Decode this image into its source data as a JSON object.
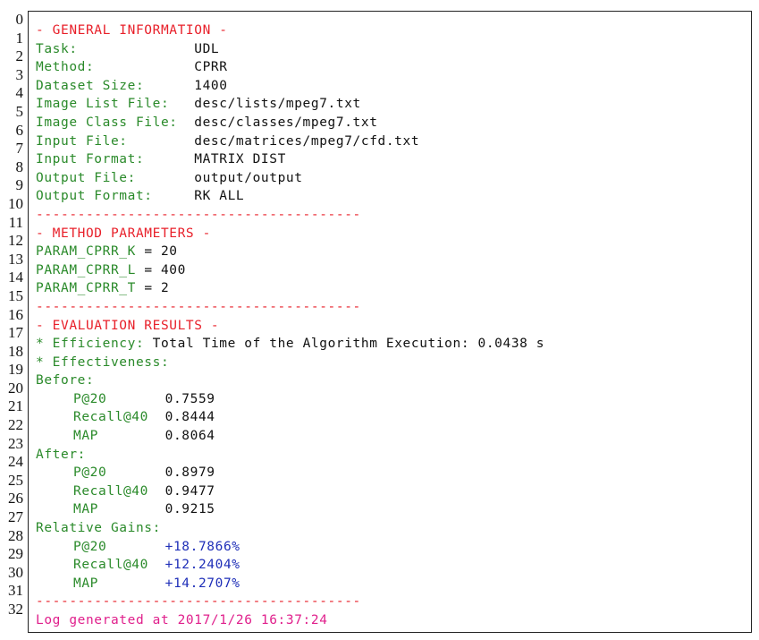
{
  "line_numbers": [
    "0",
    "1",
    "2",
    "3",
    "4",
    "5",
    "6",
    "7",
    "8",
    "9",
    "10",
    "11",
    "12",
    "13",
    "14",
    "15",
    "16",
    "17",
    "18",
    "19",
    "20",
    "21",
    "22",
    "23",
    "24",
    "25",
    "26",
    "27",
    "28",
    "29",
    "30",
    "31",
    "32"
  ],
  "general": {
    "header": "- GENERAL INFORMATION -",
    "rows": [
      {
        "label": "Task:              ",
        "value": "UDL"
      },
      {
        "label": "Method:            ",
        "value": "CPRR"
      },
      {
        "label": "Dataset Size:      ",
        "value": "1400"
      },
      {
        "label": "Image List File:   ",
        "value": "desc/lists/mpeg7.txt"
      },
      {
        "label": "Image Class File:  ",
        "value": "desc/classes/mpeg7.txt"
      },
      {
        "label": "Input File:        ",
        "value": "desc/matrices/mpeg7/cfd.txt"
      },
      {
        "label": "Input Format:      ",
        "value": "MATRIX DIST"
      },
      {
        "label": "Output File:       ",
        "value": "output/output"
      },
      {
        "label": "Output Format:     ",
        "value": "RK ALL"
      }
    ]
  },
  "separator": "---------------------------------------",
  "method": {
    "header": "- METHOD PARAMETERS -",
    "params": [
      {
        "name": "PARAM_CPRR_K",
        "value": "= 20"
      },
      {
        "name": "PARAM_CPRR_L",
        "value": "= 400"
      },
      {
        "name": "PARAM_CPRR_T",
        "value": "= 2"
      }
    ]
  },
  "evaluation": {
    "header": "- EVALUATION RESULTS -",
    "efficiency_label": "* Efficiency:",
    "efficiency_value": "Total Time of the Algorithm Execution: 0.0438 s",
    "effectiveness_label": "* Effectiveness:",
    "before_label": "Before:",
    "before": [
      {
        "metric": "P@20       ",
        "value": "0.7559"
      },
      {
        "metric": "Recall@40  ",
        "value": "0.8444"
      },
      {
        "metric": "MAP        ",
        "value": "0.8064"
      }
    ],
    "after_label": "After:",
    "after": [
      {
        "metric": "P@20       ",
        "value": "0.8979"
      },
      {
        "metric": "Recall@40  ",
        "value": "0.9477"
      },
      {
        "metric": "MAP        ",
        "value": "0.9215"
      }
    ],
    "gains_label": "Relative Gains:",
    "gains": [
      {
        "metric": "P@20       ",
        "value": "+18.7866%"
      },
      {
        "metric": "Recall@40  ",
        "value": "+12.2404%"
      },
      {
        "metric": "MAP        ",
        "value": "+14.2707%"
      }
    ]
  },
  "footer": "Log generated at 2017/1/26 16:37:24"
}
